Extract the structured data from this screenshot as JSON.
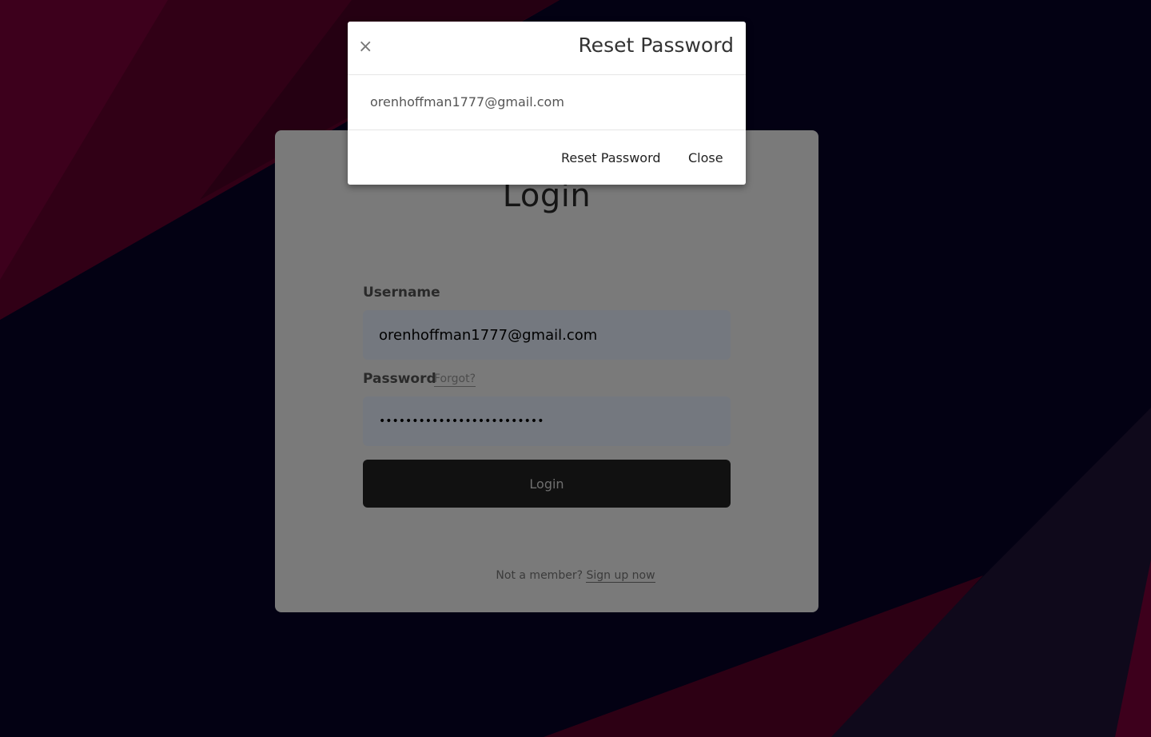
{
  "colors": {
    "background": "#070226",
    "accent_crimson": "#7a0038",
    "accent_purple": "#1e1236"
  },
  "modal": {
    "title": "Reset Password",
    "close_glyph": "×",
    "email_value": "orenhoffman1777@gmail.com",
    "reset_button_label": "Reset Password",
    "close_button_label": "Close"
  },
  "login": {
    "title": "Login",
    "username_label": "Username",
    "username_value": "orenhoffman1777@gmail.com",
    "password_label": "Password",
    "forgot_label": "Forgot?",
    "password_value": "•••••••••••••••••••••••••",
    "submit_label": "Login",
    "signup_prompt": "Not a member?",
    "signup_link_label": "Sign up now"
  }
}
